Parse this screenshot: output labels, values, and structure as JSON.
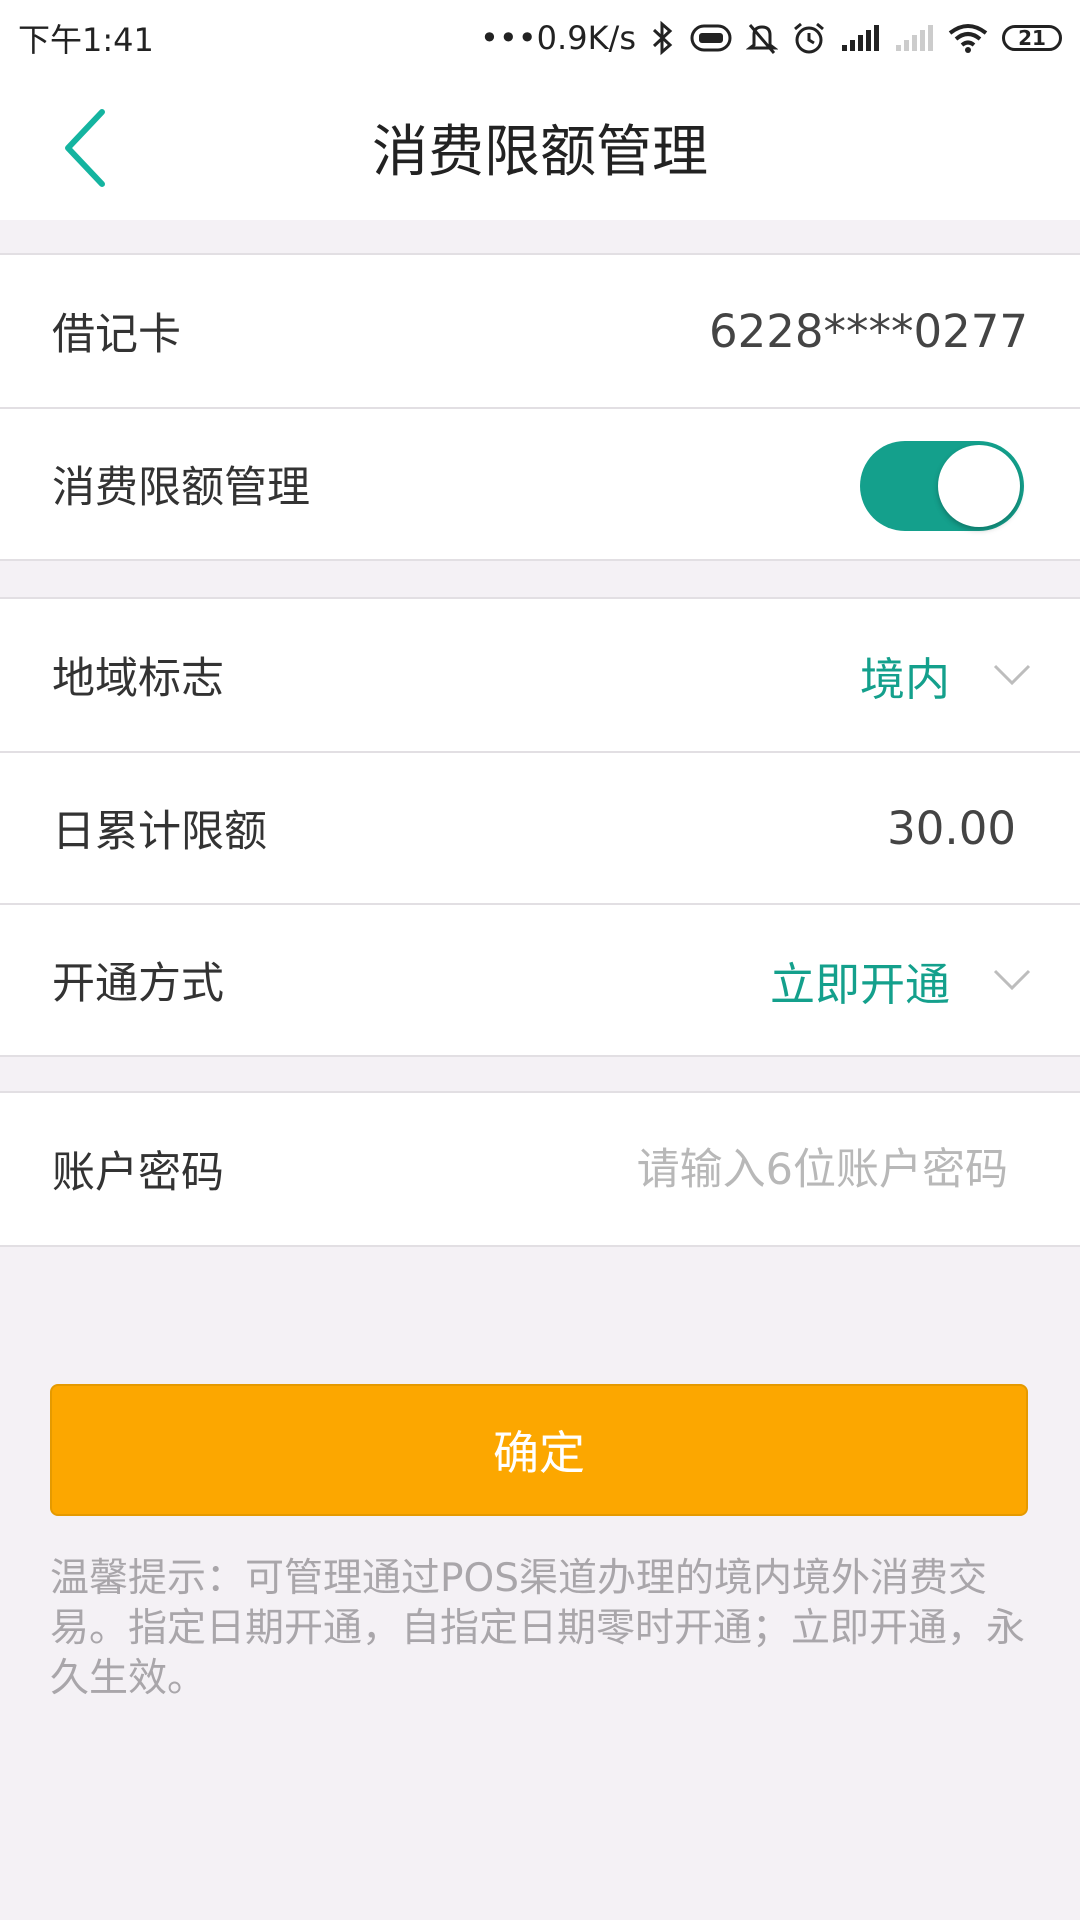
{
  "status_bar": {
    "time": "下午1:41",
    "network_speed": "•••0.9K/s",
    "battery_level": "21",
    "icons": [
      "bluetooth-icon",
      "vibrate-icon",
      "mute-icon",
      "alarm-icon",
      "signal-icon",
      "signal-weak-icon",
      "wifi-icon",
      "battery-icon"
    ]
  },
  "header": {
    "title": "消费限额管理",
    "back_icon": "chevron-left-icon"
  },
  "card_section": {
    "card_label": "借记卡",
    "card_number": "6228****0277",
    "limit_mgmt_label": "消费限额管理",
    "limit_mgmt_enabled": true
  },
  "settings_section": {
    "region_label": "地域标志",
    "region_value": "境内",
    "daily_limit_label": "日累计限额",
    "daily_limit_value": "30.00",
    "activation_label": "开通方式",
    "activation_value": "立即开通"
  },
  "password_section": {
    "label": "账户密码",
    "placeholder": "请输入6位账户密码",
    "value": ""
  },
  "confirm_label": "确定",
  "tip_text": "温馨提示：可管理通过POS渠道办理的境内境外消费交易。指定日期开通，自指定日期零时开通；立即开通，永久生效。",
  "colors": {
    "accent": "#14a08c",
    "button": "#fca700",
    "background": "#f4f1f5"
  }
}
